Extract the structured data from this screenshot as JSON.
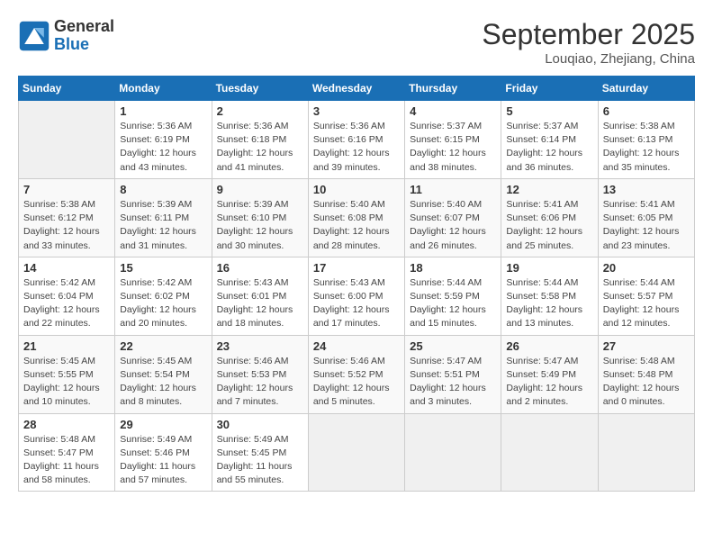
{
  "header": {
    "logo_general": "General",
    "logo_blue": "Blue",
    "month": "September 2025",
    "location": "Louqiao, Zhejiang, China"
  },
  "days_of_week": [
    "Sunday",
    "Monday",
    "Tuesday",
    "Wednesday",
    "Thursday",
    "Friday",
    "Saturday"
  ],
  "weeks": [
    [
      {
        "day": null
      },
      {
        "day": "1",
        "sunrise": "Sunrise: 5:36 AM",
        "sunset": "Sunset: 6:19 PM",
        "daylight": "Daylight: 12 hours and 43 minutes."
      },
      {
        "day": "2",
        "sunrise": "Sunrise: 5:36 AM",
        "sunset": "Sunset: 6:18 PM",
        "daylight": "Daylight: 12 hours and 41 minutes."
      },
      {
        "day": "3",
        "sunrise": "Sunrise: 5:36 AM",
        "sunset": "Sunset: 6:16 PM",
        "daylight": "Daylight: 12 hours and 39 minutes."
      },
      {
        "day": "4",
        "sunrise": "Sunrise: 5:37 AM",
        "sunset": "Sunset: 6:15 PM",
        "daylight": "Daylight: 12 hours and 38 minutes."
      },
      {
        "day": "5",
        "sunrise": "Sunrise: 5:37 AM",
        "sunset": "Sunset: 6:14 PM",
        "daylight": "Daylight: 12 hours and 36 minutes."
      },
      {
        "day": "6",
        "sunrise": "Sunrise: 5:38 AM",
        "sunset": "Sunset: 6:13 PM",
        "daylight": "Daylight: 12 hours and 35 minutes."
      }
    ],
    [
      {
        "day": "7",
        "sunrise": "Sunrise: 5:38 AM",
        "sunset": "Sunset: 6:12 PM",
        "daylight": "Daylight: 12 hours and 33 minutes."
      },
      {
        "day": "8",
        "sunrise": "Sunrise: 5:39 AM",
        "sunset": "Sunset: 6:11 PM",
        "daylight": "Daylight: 12 hours and 31 minutes."
      },
      {
        "day": "9",
        "sunrise": "Sunrise: 5:39 AM",
        "sunset": "Sunset: 6:10 PM",
        "daylight": "Daylight: 12 hours and 30 minutes."
      },
      {
        "day": "10",
        "sunrise": "Sunrise: 5:40 AM",
        "sunset": "Sunset: 6:08 PM",
        "daylight": "Daylight: 12 hours and 28 minutes."
      },
      {
        "day": "11",
        "sunrise": "Sunrise: 5:40 AM",
        "sunset": "Sunset: 6:07 PM",
        "daylight": "Daylight: 12 hours and 26 minutes."
      },
      {
        "day": "12",
        "sunrise": "Sunrise: 5:41 AM",
        "sunset": "Sunset: 6:06 PM",
        "daylight": "Daylight: 12 hours and 25 minutes."
      },
      {
        "day": "13",
        "sunrise": "Sunrise: 5:41 AM",
        "sunset": "Sunset: 6:05 PM",
        "daylight": "Daylight: 12 hours and 23 minutes."
      }
    ],
    [
      {
        "day": "14",
        "sunrise": "Sunrise: 5:42 AM",
        "sunset": "Sunset: 6:04 PM",
        "daylight": "Daylight: 12 hours and 22 minutes."
      },
      {
        "day": "15",
        "sunrise": "Sunrise: 5:42 AM",
        "sunset": "Sunset: 6:02 PM",
        "daylight": "Daylight: 12 hours and 20 minutes."
      },
      {
        "day": "16",
        "sunrise": "Sunrise: 5:43 AM",
        "sunset": "Sunset: 6:01 PM",
        "daylight": "Daylight: 12 hours and 18 minutes."
      },
      {
        "day": "17",
        "sunrise": "Sunrise: 5:43 AM",
        "sunset": "Sunset: 6:00 PM",
        "daylight": "Daylight: 12 hours and 17 minutes."
      },
      {
        "day": "18",
        "sunrise": "Sunrise: 5:44 AM",
        "sunset": "Sunset: 5:59 PM",
        "daylight": "Daylight: 12 hours and 15 minutes."
      },
      {
        "day": "19",
        "sunrise": "Sunrise: 5:44 AM",
        "sunset": "Sunset: 5:58 PM",
        "daylight": "Daylight: 12 hours and 13 minutes."
      },
      {
        "day": "20",
        "sunrise": "Sunrise: 5:44 AM",
        "sunset": "Sunset: 5:57 PM",
        "daylight": "Daylight: 12 hours and 12 minutes."
      }
    ],
    [
      {
        "day": "21",
        "sunrise": "Sunrise: 5:45 AM",
        "sunset": "Sunset: 5:55 PM",
        "daylight": "Daylight: 12 hours and 10 minutes."
      },
      {
        "day": "22",
        "sunrise": "Sunrise: 5:45 AM",
        "sunset": "Sunset: 5:54 PM",
        "daylight": "Daylight: 12 hours and 8 minutes."
      },
      {
        "day": "23",
        "sunrise": "Sunrise: 5:46 AM",
        "sunset": "Sunset: 5:53 PM",
        "daylight": "Daylight: 12 hours and 7 minutes."
      },
      {
        "day": "24",
        "sunrise": "Sunrise: 5:46 AM",
        "sunset": "Sunset: 5:52 PM",
        "daylight": "Daylight: 12 hours and 5 minutes."
      },
      {
        "day": "25",
        "sunrise": "Sunrise: 5:47 AM",
        "sunset": "Sunset: 5:51 PM",
        "daylight": "Daylight: 12 hours and 3 minutes."
      },
      {
        "day": "26",
        "sunrise": "Sunrise: 5:47 AM",
        "sunset": "Sunset: 5:49 PM",
        "daylight": "Daylight: 12 hours and 2 minutes."
      },
      {
        "day": "27",
        "sunrise": "Sunrise: 5:48 AM",
        "sunset": "Sunset: 5:48 PM",
        "daylight": "Daylight: 12 hours and 0 minutes."
      }
    ],
    [
      {
        "day": "28",
        "sunrise": "Sunrise: 5:48 AM",
        "sunset": "Sunset: 5:47 PM",
        "daylight": "Daylight: 11 hours and 58 minutes."
      },
      {
        "day": "29",
        "sunrise": "Sunrise: 5:49 AM",
        "sunset": "Sunset: 5:46 PM",
        "daylight": "Daylight: 11 hours and 57 minutes."
      },
      {
        "day": "30",
        "sunrise": "Sunrise: 5:49 AM",
        "sunset": "Sunset: 5:45 PM",
        "daylight": "Daylight: 11 hours and 55 minutes."
      },
      {
        "day": null
      },
      {
        "day": null
      },
      {
        "day": null
      },
      {
        "day": null
      }
    ]
  ]
}
